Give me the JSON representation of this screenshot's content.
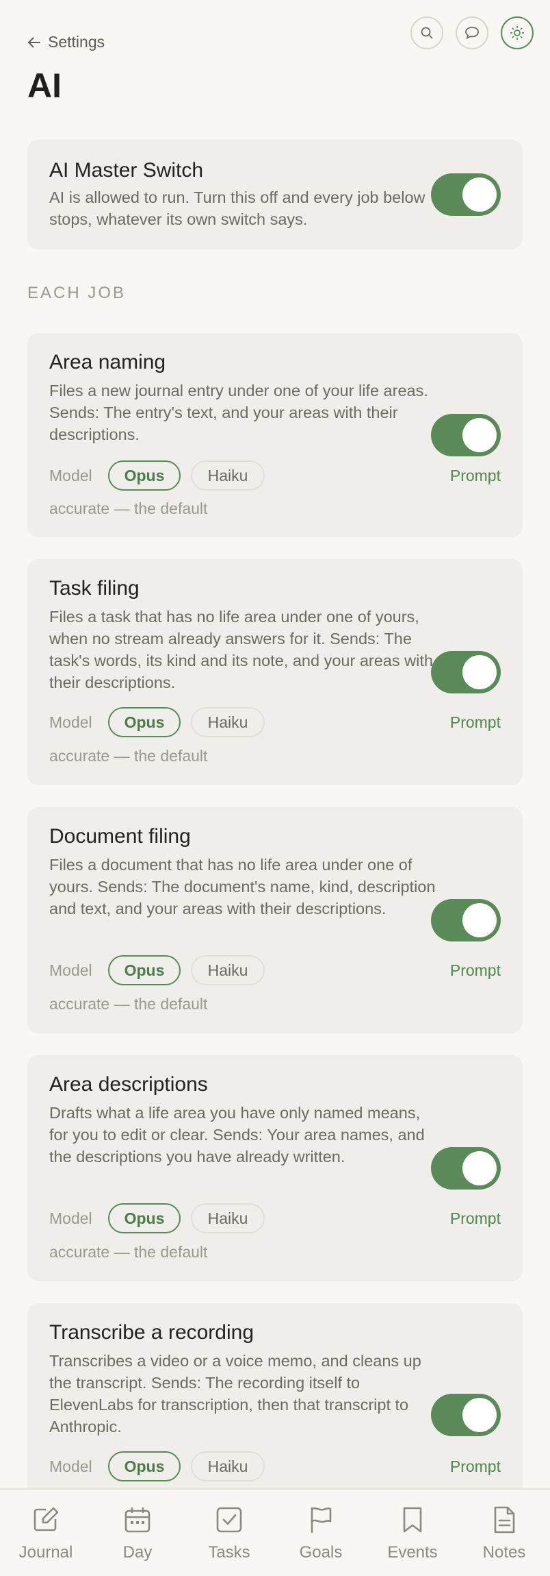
{
  "header": {
    "back_label": "Settings",
    "title": "AI",
    "icons": [
      "search-icon",
      "chat-icon",
      "sun-icon"
    ]
  },
  "master": {
    "title": "AI Master Switch",
    "description": "AI is allowed to run. Turn this off and every job below stops, whatever its own switch says.",
    "enabled": true
  },
  "section_label": "EACH JOB",
  "model_label": "Model",
  "model_options": [
    "Opus",
    "Haiku"
  ],
  "prompt_label": "Prompt",
  "jobs": [
    {
      "title": "Area naming",
      "description": "Files a new journal entry under one of your life areas. Sends: The entry's text, and your areas with their descriptions.",
      "enabled": true,
      "selected_model": "Opus",
      "note": "accurate — the default"
    },
    {
      "title": "Task filing",
      "description": "Files a task that has no life area under one of yours, when no stream already answers for it. Sends: The task's words, its kind and its note, and your areas with their descriptions.",
      "enabled": true,
      "selected_model": "Opus",
      "note": "accurate — the default"
    },
    {
      "title": "Document filing",
      "description": "Files a document that has no life area under one of yours. Sends: The document's name, kind, description and text, and your areas with their descriptions.",
      "enabled": true,
      "selected_model": "Opus",
      "note": "accurate — the default"
    },
    {
      "title": "Area descriptions",
      "description": "Drafts what a life area you have only named means, for you to edit or clear. Sends: Your area names, and the descriptions you have already written.",
      "enabled": true,
      "selected_model": "Opus",
      "note": "accurate — the default"
    },
    {
      "title": "Transcribe a recording",
      "description": "Transcribes a video or a voice memo, and cleans up the transcript. Sends: The recording itself to ElevenLabs for transcription, then that transcript to Anthropic.",
      "enabled": true,
      "selected_model": "Opus"
    }
  ],
  "nav": [
    {
      "label": "Journal",
      "icon": "pencil-icon"
    },
    {
      "label": "Day",
      "icon": "calendar-icon"
    },
    {
      "label": "Tasks",
      "icon": "checkbox-icon"
    },
    {
      "label": "Goals",
      "icon": "flag-icon"
    },
    {
      "label": "Events",
      "icon": "bookmark-icon"
    },
    {
      "label": "Notes",
      "icon": "document-icon"
    }
  ],
  "colors": {
    "accent": "#5a8a58",
    "background": "#f8f7f3",
    "card": "#f0eeea"
  }
}
